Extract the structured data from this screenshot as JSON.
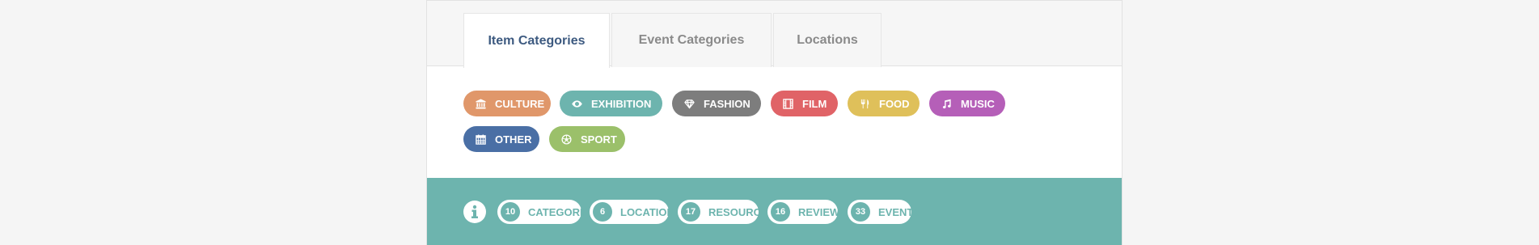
{
  "tabs": [
    {
      "label": "Item Categories",
      "active": true
    },
    {
      "label": "Event Categories",
      "active": false
    },
    {
      "label": "Locations",
      "active": false
    }
  ],
  "categories": [
    {
      "label": "CULTURE",
      "color": "#e0976a",
      "icon": "museum-icon"
    },
    {
      "label": "EXHIBITION",
      "color": "#6db4ae",
      "icon": "eye-icon"
    },
    {
      "label": "FASHION",
      "color": "#7d7d7d",
      "icon": "diamond-icon"
    },
    {
      "label": "FILM",
      "color": "#e06367",
      "icon": "film-icon"
    },
    {
      "label": "FOOD",
      "color": "#dfc05a",
      "icon": "cutlery-icon"
    },
    {
      "label": "MUSIC",
      "color": "#b55fb8",
      "icon": "music-note-icon"
    },
    {
      "label": "OTHER",
      "color": "#4a6fa5",
      "icon": "calendar-icon"
    },
    {
      "label": "SPORT",
      "color": "#9bc06a",
      "icon": "soccer-ball-icon"
    }
  ],
  "stats": [
    {
      "count": "10",
      "label": "CATEGORIES"
    },
    {
      "count": "6",
      "label": "LOCATIONS"
    },
    {
      "count": "17",
      "label": "RESOURCES"
    },
    {
      "count": "16",
      "label": "REVIEWS"
    },
    {
      "count": "33",
      "label": "EVENTS"
    }
  ],
  "colors": {
    "accent": "#6db4ae",
    "tab_active_text": "#3d5a80"
  }
}
